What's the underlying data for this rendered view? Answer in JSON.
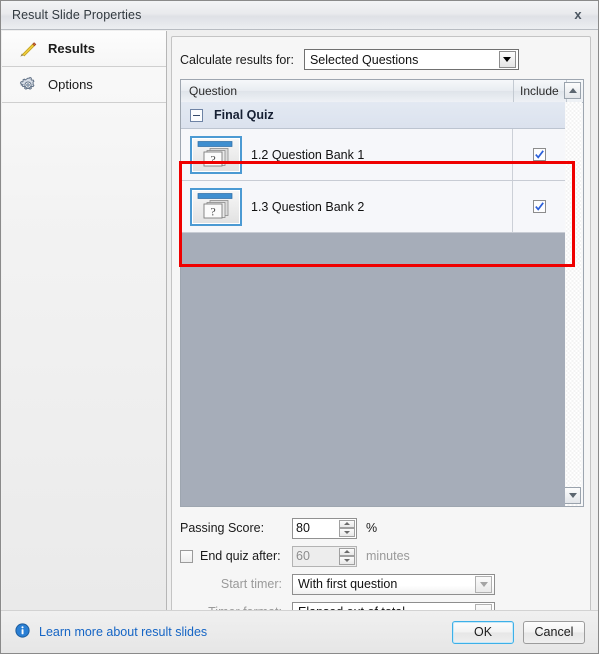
{
  "window": {
    "title": "Result Slide Properties",
    "close_label": "x"
  },
  "sidebar": {
    "items": [
      {
        "label": "Results",
        "icon": "pencil-icon",
        "selected": true
      },
      {
        "label": "Options",
        "icon": "gear-icon",
        "selected": false
      }
    ]
  },
  "main": {
    "calculate": {
      "label": "Calculate results for:",
      "selected": "Selected Questions"
    },
    "list": {
      "columns": [
        "Question",
        "Include"
      ],
      "group": {
        "label": "Final Quiz",
        "expanded": true
      },
      "rows": [
        {
          "icon": "question-bank-icon",
          "label": "1.2 Question Bank 1",
          "include": true,
          "highlighted": true
        },
        {
          "icon": "question-bank-icon",
          "label": "1.3 Question Bank 2",
          "include": true,
          "highlighted": true
        }
      ],
      "icon_glyph": "?"
    },
    "form": {
      "passing_score_label": "Passing Score:",
      "passing_score_value": "80",
      "passing_score_unit": "%",
      "end_quiz_label": "End quiz after:",
      "end_quiz_checked": false,
      "end_quiz_value": "60",
      "end_quiz_unit": "minutes",
      "start_timer_label": "Start timer:",
      "start_timer_value": "With first question",
      "timer_format_label": "Timer format:",
      "timer_format_value": "Elapsed out of total"
    }
  },
  "footer": {
    "learn_more": "Learn more about result slides",
    "learn_more_icon": "info-icon",
    "ok": "OK",
    "cancel": "Cancel"
  },
  "colors": {
    "accent_blue": "#1565c5",
    "highlight_red": "#ef0000",
    "selection_blue": "#4b9ad3",
    "list_empty_bg": "#a6adb9"
  }
}
